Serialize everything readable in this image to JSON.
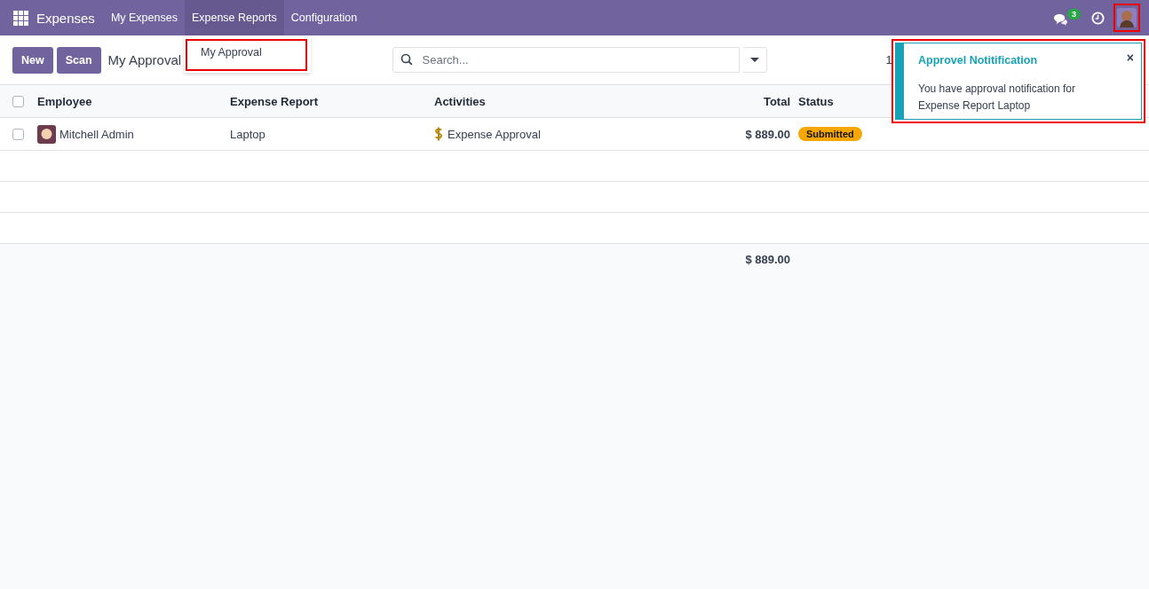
{
  "navbar": {
    "app": "Expenses",
    "menus": [
      {
        "label": "My Expenses",
        "selected": false
      },
      {
        "label": "Expense Reports",
        "selected": true
      },
      {
        "label": "Configuration",
        "selected": false
      }
    ],
    "messages_badge": "3"
  },
  "dropdown": {
    "items": [
      {
        "label": "My Approval"
      }
    ]
  },
  "control_panel": {
    "buttons": [
      "New",
      "Scan"
    ],
    "breadcrumb": "My Approval",
    "search": {
      "placeholder": "Search..."
    },
    "pager": "1"
  },
  "table": {
    "select_all_checked": false,
    "columns": [
      "Employee",
      "Expense Report",
      "Activities",
      "Total",
      "Status"
    ],
    "rows": [
      {
        "checked": false,
        "employee": "Mitchell Admin",
        "expense_report": "Laptop",
        "activity": "Expense Approval",
        "total": "$ 889.00",
        "status": "Submitted"
      }
    ],
    "footer_total": "$ 889.00"
  },
  "notification": {
    "title": "Approvel Notitification",
    "message": "You have approval notification for Expense Report Laptop",
    "close": "×"
  }
}
